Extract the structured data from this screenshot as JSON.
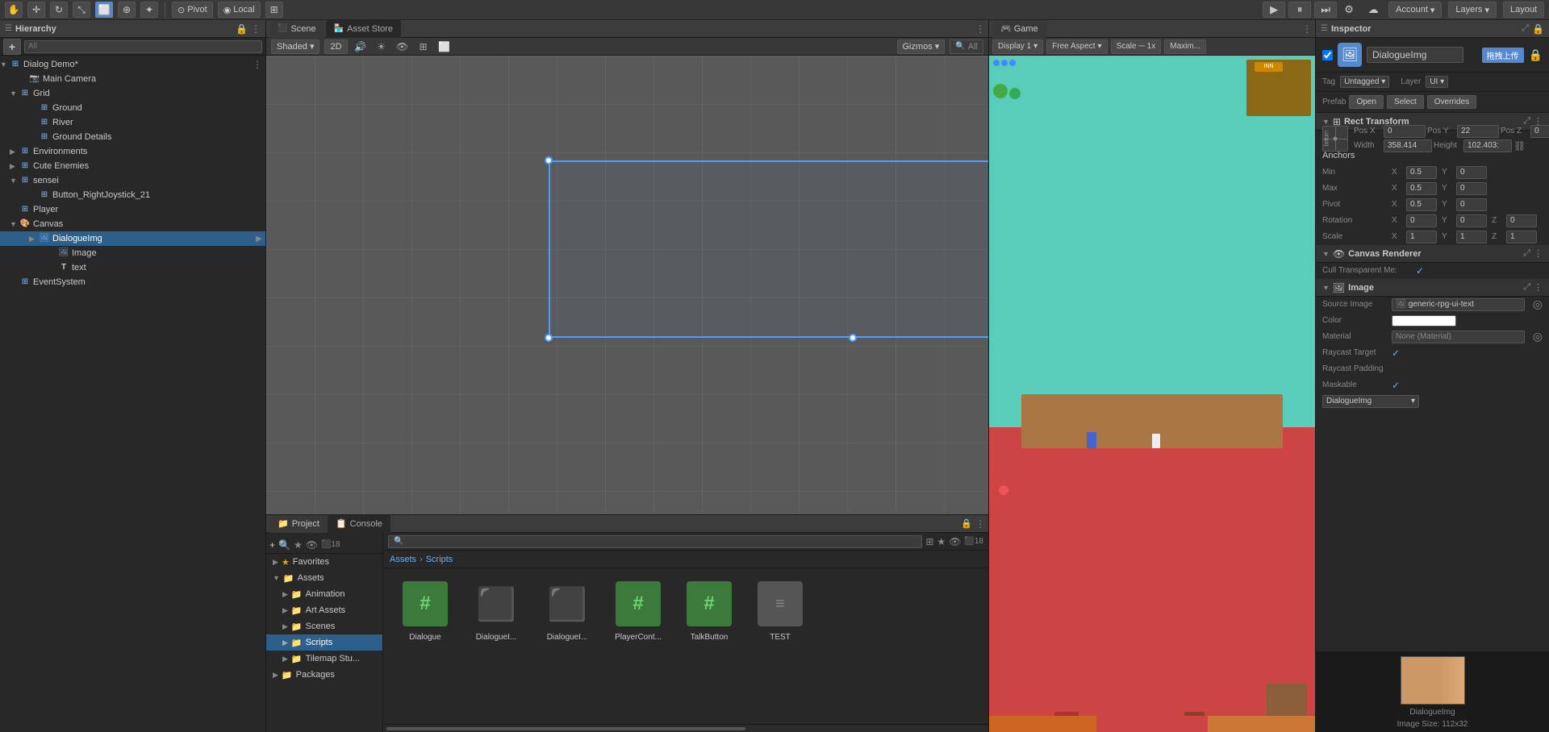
{
  "topbar": {
    "tools": [
      "hand",
      "move",
      "rotate",
      "scale",
      "rect",
      "transform",
      "custom"
    ],
    "pivot_label": "Pivot",
    "local_label": "Local",
    "play_icon": "▶",
    "pause_icon": "⏸",
    "step_icon": "⏭",
    "account_label": "Account",
    "layers_label": "Layers",
    "layout_label": "Layout"
  },
  "hierarchy": {
    "title": "Hierarchy",
    "search_placeholder": "All",
    "tree": [
      {
        "id": "dialog_demo",
        "label": "Dialog Demo*",
        "indent": 0,
        "arrow": "▼",
        "icon": "📦",
        "modified": true
      },
      {
        "id": "main_camera",
        "label": "Main Camera",
        "indent": 2,
        "arrow": "",
        "icon": "📷"
      },
      {
        "id": "grid",
        "label": "Grid",
        "indent": 1,
        "arrow": "▼",
        "icon": "⊞"
      },
      {
        "id": "ground",
        "label": "Ground",
        "indent": 3,
        "arrow": "",
        "icon": "⊞"
      },
      {
        "id": "river",
        "label": "River",
        "indent": 3,
        "arrow": "",
        "icon": "⊞"
      },
      {
        "id": "ground_details",
        "label": "Ground Details",
        "indent": 3,
        "arrow": "",
        "icon": "⊞"
      },
      {
        "id": "environments",
        "label": "Environments",
        "indent": 1,
        "arrow": "▶",
        "icon": "⊞"
      },
      {
        "id": "cute_enemies",
        "label": "Cute Enemies",
        "indent": 1,
        "arrow": "▶",
        "icon": "⊞"
      },
      {
        "id": "sensei",
        "label": "sensei",
        "indent": 1,
        "arrow": "▼",
        "icon": "⊞"
      },
      {
        "id": "button_right",
        "label": "Button_RightJoystick_21",
        "indent": 3,
        "arrow": "",
        "icon": "⊞"
      },
      {
        "id": "player",
        "label": "Player",
        "indent": 1,
        "arrow": "",
        "icon": "⊞"
      },
      {
        "id": "canvas",
        "label": "Canvas",
        "indent": 1,
        "arrow": "▼",
        "icon": "🎨"
      },
      {
        "id": "dialogueimg",
        "label": "DialogueImg",
        "indent": 3,
        "arrow": "▶",
        "icon": "🖼",
        "selected": true
      },
      {
        "id": "image",
        "label": "Image",
        "indent": 5,
        "arrow": "",
        "icon": "🖼"
      },
      {
        "id": "text",
        "label": "text",
        "indent": 5,
        "arrow": "",
        "icon": "T"
      },
      {
        "id": "eventsystem",
        "label": "EventSystem",
        "indent": 1,
        "arrow": "",
        "icon": "⊞"
      }
    ]
  },
  "scene": {
    "tabs": [
      "Scene",
      "Asset Store"
    ],
    "active_tab": "Scene",
    "shading_mode": "Shaded",
    "view_mode": "2D",
    "gizmos_label": "Gizmos",
    "search_placeholder": "All"
  },
  "project": {
    "tabs": [
      "Project",
      "Console"
    ],
    "active_tab": "Project",
    "add_button": "+",
    "search_placeholder": "",
    "sidebar_items": [
      {
        "label": "Favorites",
        "icon": "★",
        "expanded": true
      },
      {
        "label": "Assets",
        "icon": "📁",
        "expanded": true
      },
      {
        "label": "Animation",
        "icon": "📁",
        "indent": 1
      },
      {
        "label": "Art Assets",
        "icon": "📁",
        "indent": 1
      },
      {
        "label": "Scenes",
        "icon": "📁",
        "indent": 1
      },
      {
        "label": "Scripts",
        "icon": "📁",
        "indent": 1,
        "selected": true
      },
      {
        "label": "Tilemap Stu...",
        "icon": "📁",
        "indent": 1
      },
      {
        "label": "Packages",
        "icon": "📁",
        "expanded": false
      }
    ],
    "breadcrumb": [
      "Assets",
      "Scripts"
    ],
    "files": [
      {
        "name": "Dialogue",
        "type": "cs_hash"
      },
      {
        "name": "DialogueI...",
        "type": "cube_blue"
      },
      {
        "name": "DialogueI...",
        "type": "cube_cyan"
      },
      {
        "name": "PlayerCont...",
        "type": "cs_hash"
      },
      {
        "name": "TalkButton",
        "type": "cs_hash"
      },
      {
        "name": "TEST",
        "type": "cs_lines"
      }
    ]
  },
  "game": {
    "tab_label": "Game",
    "display_label": "Display 1",
    "aspect_label": "Free Aspect",
    "scale_label": "Scale",
    "scale_value": "1x",
    "maximize_label": "Maximize On Play",
    "maximize_short": "Maxim..."
  },
  "inspector": {
    "title": "Inspector",
    "object_name": "DialogueImg",
    "upload_label": "拖拽上传",
    "tag_label": "Tag",
    "tag_value": "Untagged",
    "layer_label": "Layer",
    "layer_value": "UI",
    "prefab_buttons": [
      "Open",
      "Select",
      "Overrides"
    ],
    "rect_transform": {
      "title": "Rect Transform",
      "pos_x_label": "Pos X",
      "pos_y_label": "Pos Y",
      "pos_z_label": "Pos Z",
      "pos_x": "0",
      "pos_y": "22",
      "pos_z": "0",
      "width_label": "Width",
      "height_label": "Height",
      "width": "358.414",
      "height": "102.403",
      "anchor_label": "Anchors",
      "min_label": "Min",
      "min_x": "0.5",
      "min_y": "0",
      "max_label": "Max",
      "max_x": "0.5",
      "max_y": "0",
      "pivot_label": "Pivot",
      "pivot_x": "0.5",
      "pivot_y": "0",
      "rotation_label": "Rotation",
      "rot_x": "0",
      "rot_y": "0",
      "rot_z": "0",
      "scale_label": "Scale",
      "scale_x": "1",
      "scale_y": "1",
      "scale_z": "1"
    },
    "canvas_renderer": {
      "title": "Canvas Renderer",
      "cull_label": "Cull Transparent Me:",
      "cull_value": "✓"
    },
    "image_component": {
      "title": "Image",
      "source_image_label": "Source Image",
      "source_image_value": "generic-rpg-ui-text",
      "color_label": "Color",
      "material_label": "Material",
      "material_value": "None (Material)",
      "raycast_label": "Raycast Target",
      "raycast_value": "✓",
      "raycast_padding_label": "Raycast Padding",
      "maskable_label": "Maskable",
      "maskable_value": "✓",
      "image_type_label": "DialogueImg",
      "image_type_value": "DialogueImg"
    },
    "preview": {
      "name": "DialogueImg",
      "size": "Image Size: 112x32"
    }
  }
}
